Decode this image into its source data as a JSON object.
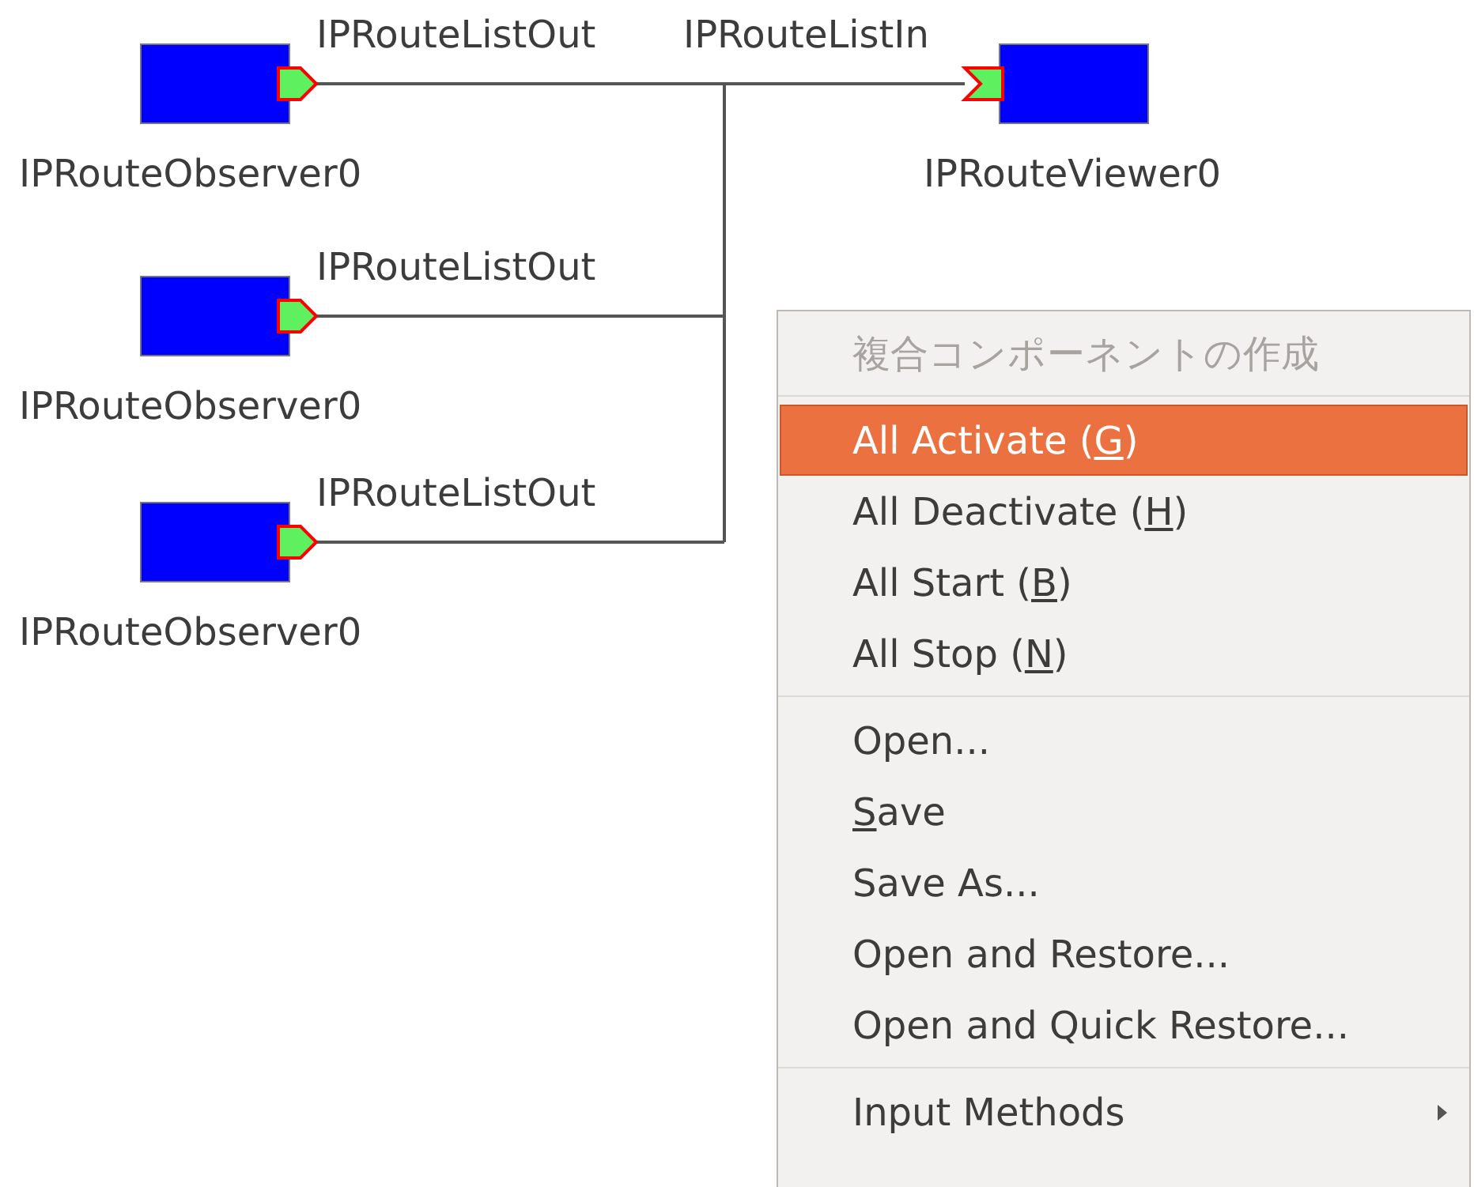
{
  "diagram": {
    "components": [
      {
        "name": "IPRouteObserver0",
        "kind": "observer",
        "port": {
          "label": "IPRouteListOut",
          "kind": "out"
        }
      },
      {
        "name": "IPRouteObserver0",
        "kind": "observer",
        "port": {
          "label": "IPRouteListOut",
          "kind": "out"
        }
      },
      {
        "name": "IPRouteObserver0",
        "kind": "observer",
        "port": {
          "label": "IPRouteListOut",
          "kind": "out"
        }
      },
      {
        "name": "IPRouteViewer0",
        "kind": "viewer",
        "port": {
          "label": "IPRouteListIn",
          "kind": "in"
        }
      }
    ]
  },
  "context_menu": {
    "sections": [
      [
        {
          "before": "複合コンポーネントの作成",
          "disabled": true,
          "selected": false
        }
      ],
      [
        {
          "before": "All Activate (",
          "mnemonic": "G",
          "after": ")",
          "disabled": false,
          "selected": true
        },
        {
          "before": "All Deactivate (",
          "mnemonic": "H",
          "after": ")",
          "disabled": false,
          "selected": false
        },
        {
          "before": "All Start (",
          "mnemonic": "B",
          "after": ")",
          "disabled": false,
          "selected": false
        },
        {
          "before": "All Stop (",
          "mnemonic": "N",
          "after": ")",
          "disabled": false,
          "selected": false
        }
      ],
      [
        {
          "before": "Open...",
          "disabled": false,
          "selected": false
        },
        {
          "mnemonic": "S",
          "after": "ave",
          "disabled": false,
          "selected": false
        },
        {
          "before": "Save As...",
          "disabled": false,
          "selected": false
        },
        {
          "before": "Open and Restore...",
          "disabled": false,
          "selected": false
        },
        {
          "before": "Open and Quick Restore...",
          "disabled": false,
          "selected": false
        }
      ],
      [
        {
          "before": "Input Methods",
          "kind": "submenu",
          "disabled": false,
          "selected": false
        }
      ]
    ]
  }
}
